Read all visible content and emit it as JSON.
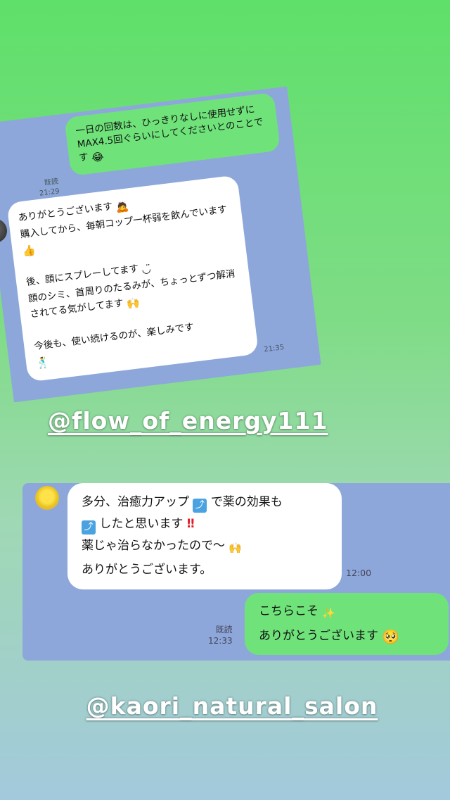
{
  "chat1": {
    "sent_message": "一日の回数は、ひっきりなしに使用せずに\nMAX4.5回ぐらいにしてくださいとのことです",
    "sent_emoji": "😂",
    "sent_status": "既読",
    "sent_time": "21:29",
    "received_lines": [
      "ありがとうございます",
      "購入してから、毎朝コップ一杯弱を飲んでいます",
      "後、顔にスプレーしてます",
      "顔のシミ、首周りのたるみが、ちょっとずつ解消されてる気がしてます",
      "今後も、使い続けるのが、楽しみです"
    ],
    "received_time": "21:35"
  },
  "tags": {
    "tag1": "@flow_of_energy111",
    "tag2": "@kaori_natural_salon"
  },
  "chat2": {
    "received_line1_a": "多分、治癒力アップ",
    "received_line1_b": "で薬の効果も",
    "received_line2": "したと思います",
    "received_line3": "薬じゃ治らなかったので〜",
    "received_line4": "ありがとうございます。",
    "received_time": "12:00",
    "sent_line1": "こちらこそ",
    "sent_line2": "ありがとうございます",
    "sent_status": "既読",
    "sent_time": "12:33"
  },
  "icons": {
    "arrow": "up-arrow-icon",
    "double_exclamation": "double-exclamation-icon",
    "sparkles": "sparkles-icon",
    "raised_hands": "raised-hands-icon",
    "praying_face": "praying-face-icon"
  },
  "colors": {
    "bubble_green": "#6fe37a",
    "chat_background": "#8da7da"
  }
}
